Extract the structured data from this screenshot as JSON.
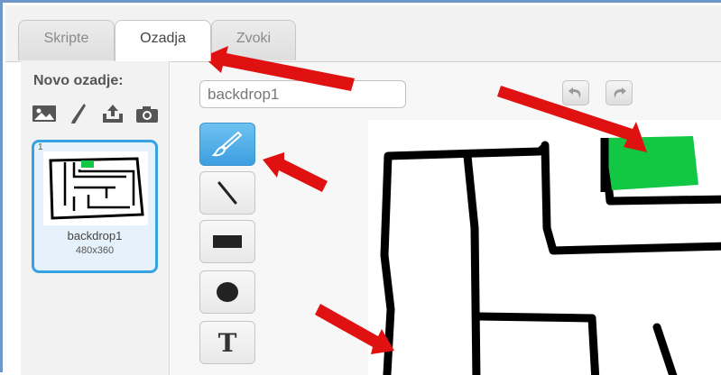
{
  "tabs": [
    {
      "label": "Skripte",
      "active": false
    },
    {
      "label": "Ozadja",
      "active": true
    },
    {
      "label": "Zvoki",
      "active": false
    }
  ],
  "left_panel": {
    "title": "Novo ozadje:",
    "new_backdrop_icons": [
      "image-library-icon",
      "paint-brush-icon",
      "upload-icon",
      "camera-icon"
    ],
    "backdrops": [
      {
        "number": "1",
        "name": "backdrop1",
        "size": "480x360",
        "selected": true
      }
    ]
  },
  "editor": {
    "name_value": "backdrop1",
    "undo_icon": "undo-icon",
    "redo_icon": "redo-icon",
    "tools": [
      {
        "name": "brush-tool",
        "icon": "brush-icon",
        "selected": true
      },
      {
        "name": "line-tool",
        "icon": "line-icon",
        "selected": false
      },
      {
        "name": "rectangle-tool",
        "icon": "rectangle-icon",
        "selected": false
      },
      {
        "name": "ellipse-tool",
        "icon": "ellipse-icon",
        "selected": false
      },
      {
        "name": "text-tool",
        "icon": "text-icon",
        "label": "T",
        "selected": false
      }
    ]
  },
  "colors": {
    "selected_accent": "#35a3e3",
    "maze_goal_green": "#11c744",
    "annotation_arrow_red": "#e01111"
  }
}
